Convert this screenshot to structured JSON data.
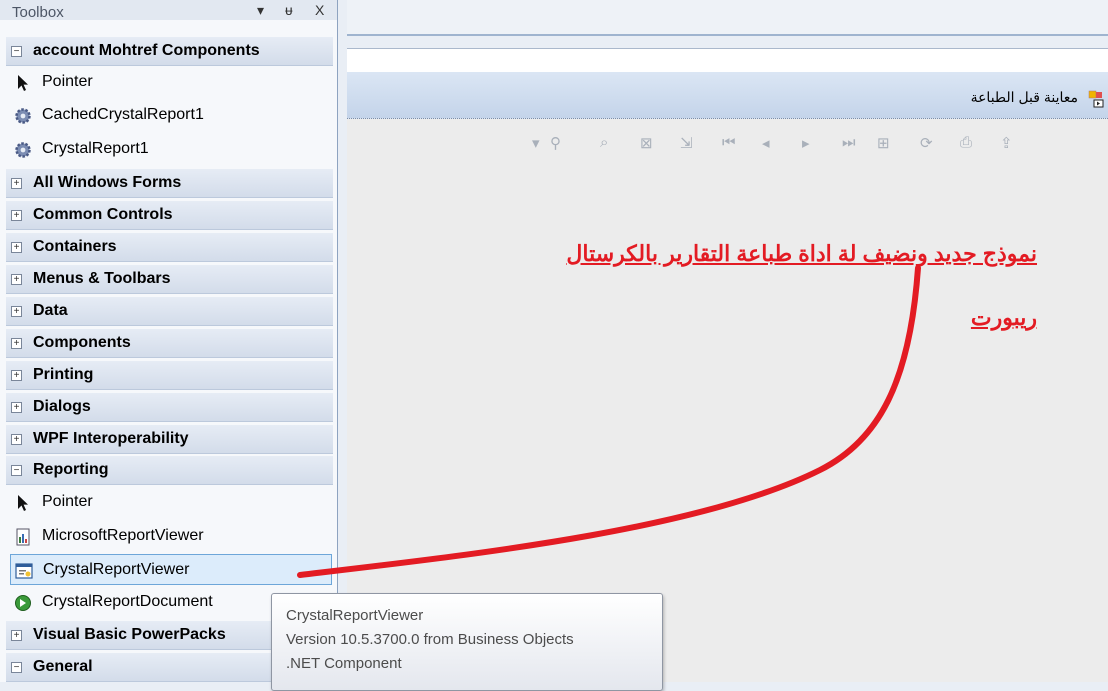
{
  "toolbox": {
    "title": "Toolbox",
    "controls": {
      "pin": "▾",
      "autohide": "ᵾ",
      "close": "X"
    },
    "groups": [
      {
        "label": "account Mohtref Components",
        "expanded": true
      },
      {
        "label": "All Windows Forms",
        "expanded": false
      },
      {
        "label": "Common Controls",
        "expanded": false
      },
      {
        "label": "Containers",
        "expanded": false
      },
      {
        "label": "Menus & Toolbars",
        "expanded": false
      },
      {
        "label": "Data",
        "expanded": false
      },
      {
        "label": "Components",
        "expanded": false
      },
      {
        "label": "Printing",
        "expanded": false
      },
      {
        "label": "Dialogs",
        "expanded": false
      },
      {
        "label": "WPF Interoperability",
        "expanded": false
      },
      {
        "label": "Reporting",
        "expanded": true
      },
      {
        "label": "Visual Basic PowerPacks",
        "expanded": false
      },
      {
        "label": "General",
        "expanded": true
      }
    ],
    "items": [
      {
        "label": "Pointer",
        "icon": "pointer-icon"
      },
      {
        "label": "CachedCrystalReport1",
        "icon": "gear-icon"
      },
      {
        "label": "CrystalReport1",
        "icon": "gear-icon"
      },
      {
        "label": "Pointer",
        "icon": "pointer-icon"
      },
      {
        "label": "MicrosoftReportViewer",
        "icon": "report-viewer-icon"
      },
      {
        "label": "CrystalReportViewer",
        "icon": "crystal-viewer-icon",
        "selected": true
      },
      {
        "label": "CrystalReportDocument",
        "icon": "crystal-document-icon"
      }
    ]
  },
  "form": {
    "title": "معاينة قبل الطباعة"
  },
  "annotation": {
    "line1": "نموذج جديد ونضيف لة اداة طباعة التقارير بالكرستال",
    "line2": "ريبورت"
  },
  "tooltip": {
    "name": "CrystalReportViewer",
    "version": "Version 10.5.3700.0 from Business Objects",
    "kind": ".NET Component"
  },
  "colors": {
    "annotation": "#e31b23",
    "selection": "#dcecfb"
  }
}
